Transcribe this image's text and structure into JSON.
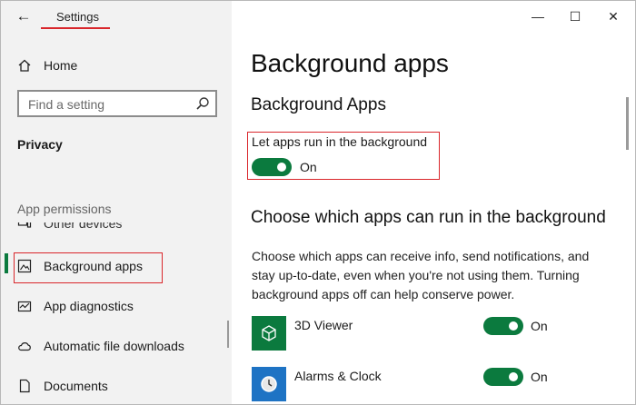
{
  "window": {
    "title": "Settings",
    "controls": {
      "minimize": "—",
      "maximize": "☐",
      "close": "✕"
    }
  },
  "sidebar": {
    "home_label": "Home",
    "search": {
      "placeholder": "Find a setting",
      "value": ""
    },
    "section_label": "Privacy",
    "group_label": "App permissions",
    "items": [
      {
        "label": "Other devices",
        "icon": "devices-icon"
      },
      {
        "label": "Background apps",
        "icon": "background-apps-icon",
        "selected": true
      },
      {
        "label": "App diagnostics",
        "icon": "diagnostics-icon"
      },
      {
        "label": "Automatic file downloads",
        "icon": "cloud-icon"
      },
      {
        "label": "Documents",
        "icon": "document-icon"
      }
    ]
  },
  "main": {
    "page_title": "Background apps",
    "sub_heading": "Background Apps",
    "master_toggle": {
      "label": "Let apps run in the background",
      "state_text": "On",
      "on": true
    },
    "section_heading": "Choose which apps can run in the background",
    "description": "Choose which apps can receive info, send notifications, and stay up-to-date, even when you're not using them. Turning background apps off can help conserve power.",
    "apps": [
      {
        "name": "3D Viewer",
        "state_text": "On",
        "on": true,
        "icon": "3d-viewer-icon"
      },
      {
        "name": "Alarms & Clock",
        "state_text": "On",
        "on": true,
        "icon": "alarm-clock-icon"
      }
    ]
  },
  "colors": {
    "accent": "#0b7a3e",
    "highlight": "#d9262b",
    "sidebar_bg": "#f2f2f2"
  }
}
